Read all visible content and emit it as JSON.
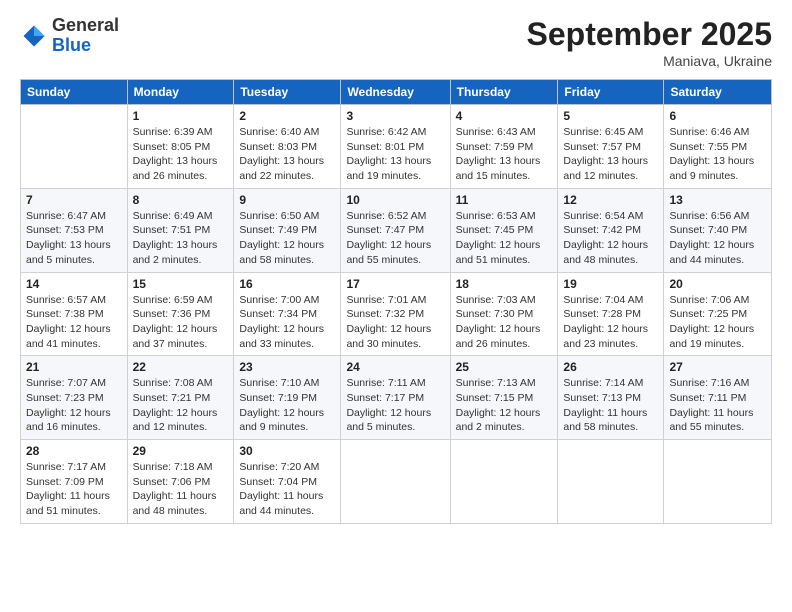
{
  "header": {
    "logo_general": "General",
    "logo_blue": "Blue",
    "month_title": "September 2025",
    "location": "Maniava, Ukraine"
  },
  "days_of_week": [
    "Sunday",
    "Monday",
    "Tuesday",
    "Wednesday",
    "Thursday",
    "Friday",
    "Saturday"
  ],
  "weeks": [
    [
      null,
      {
        "day": 1,
        "sunrise": "Sunrise: 6:39 AM",
        "sunset": "Sunset: 8:05 PM",
        "daylight": "Daylight: 13 hours and 26 minutes."
      },
      {
        "day": 2,
        "sunrise": "Sunrise: 6:40 AM",
        "sunset": "Sunset: 8:03 PM",
        "daylight": "Daylight: 13 hours and 22 minutes."
      },
      {
        "day": 3,
        "sunrise": "Sunrise: 6:42 AM",
        "sunset": "Sunset: 8:01 PM",
        "daylight": "Daylight: 13 hours and 19 minutes."
      },
      {
        "day": 4,
        "sunrise": "Sunrise: 6:43 AM",
        "sunset": "Sunset: 7:59 PM",
        "daylight": "Daylight: 13 hours and 15 minutes."
      },
      {
        "day": 5,
        "sunrise": "Sunrise: 6:45 AM",
        "sunset": "Sunset: 7:57 PM",
        "daylight": "Daylight: 13 hours and 12 minutes."
      },
      {
        "day": 6,
        "sunrise": "Sunrise: 6:46 AM",
        "sunset": "Sunset: 7:55 PM",
        "daylight": "Daylight: 13 hours and 9 minutes."
      }
    ],
    [
      {
        "day": 7,
        "sunrise": "Sunrise: 6:47 AM",
        "sunset": "Sunset: 7:53 PM",
        "daylight": "Daylight: 13 hours and 5 minutes."
      },
      {
        "day": 8,
        "sunrise": "Sunrise: 6:49 AM",
        "sunset": "Sunset: 7:51 PM",
        "daylight": "Daylight: 13 hours and 2 minutes."
      },
      {
        "day": 9,
        "sunrise": "Sunrise: 6:50 AM",
        "sunset": "Sunset: 7:49 PM",
        "daylight": "Daylight: 12 hours and 58 minutes."
      },
      {
        "day": 10,
        "sunrise": "Sunrise: 6:52 AM",
        "sunset": "Sunset: 7:47 PM",
        "daylight": "Daylight: 12 hours and 55 minutes."
      },
      {
        "day": 11,
        "sunrise": "Sunrise: 6:53 AM",
        "sunset": "Sunset: 7:45 PM",
        "daylight": "Daylight: 12 hours and 51 minutes."
      },
      {
        "day": 12,
        "sunrise": "Sunrise: 6:54 AM",
        "sunset": "Sunset: 7:42 PM",
        "daylight": "Daylight: 12 hours and 48 minutes."
      },
      {
        "day": 13,
        "sunrise": "Sunrise: 6:56 AM",
        "sunset": "Sunset: 7:40 PM",
        "daylight": "Daylight: 12 hours and 44 minutes."
      }
    ],
    [
      {
        "day": 14,
        "sunrise": "Sunrise: 6:57 AM",
        "sunset": "Sunset: 7:38 PM",
        "daylight": "Daylight: 12 hours and 41 minutes."
      },
      {
        "day": 15,
        "sunrise": "Sunrise: 6:59 AM",
        "sunset": "Sunset: 7:36 PM",
        "daylight": "Daylight: 12 hours and 37 minutes."
      },
      {
        "day": 16,
        "sunrise": "Sunrise: 7:00 AM",
        "sunset": "Sunset: 7:34 PM",
        "daylight": "Daylight: 12 hours and 33 minutes."
      },
      {
        "day": 17,
        "sunrise": "Sunrise: 7:01 AM",
        "sunset": "Sunset: 7:32 PM",
        "daylight": "Daylight: 12 hours and 30 minutes."
      },
      {
        "day": 18,
        "sunrise": "Sunrise: 7:03 AM",
        "sunset": "Sunset: 7:30 PM",
        "daylight": "Daylight: 12 hours and 26 minutes."
      },
      {
        "day": 19,
        "sunrise": "Sunrise: 7:04 AM",
        "sunset": "Sunset: 7:28 PM",
        "daylight": "Daylight: 12 hours and 23 minutes."
      },
      {
        "day": 20,
        "sunrise": "Sunrise: 7:06 AM",
        "sunset": "Sunset: 7:25 PM",
        "daylight": "Daylight: 12 hours and 19 minutes."
      }
    ],
    [
      {
        "day": 21,
        "sunrise": "Sunrise: 7:07 AM",
        "sunset": "Sunset: 7:23 PM",
        "daylight": "Daylight: 12 hours and 16 minutes."
      },
      {
        "day": 22,
        "sunrise": "Sunrise: 7:08 AM",
        "sunset": "Sunset: 7:21 PM",
        "daylight": "Daylight: 12 hours and 12 minutes."
      },
      {
        "day": 23,
        "sunrise": "Sunrise: 7:10 AM",
        "sunset": "Sunset: 7:19 PM",
        "daylight": "Daylight: 12 hours and 9 minutes."
      },
      {
        "day": 24,
        "sunrise": "Sunrise: 7:11 AM",
        "sunset": "Sunset: 7:17 PM",
        "daylight": "Daylight: 12 hours and 5 minutes."
      },
      {
        "day": 25,
        "sunrise": "Sunrise: 7:13 AM",
        "sunset": "Sunset: 7:15 PM",
        "daylight": "Daylight: 12 hours and 2 minutes."
      },
      {
        "day": 26,
        "sunrise": "Sunrise: 7:14 AM",
        "sunset": "Sunset: 7:13 PM",
        "daylight": "Daylight: 11 hours and 58 minutes."
      },
      {
        "day": 27,
        "sunrise": "Sunrise: 7:16 AM",
        "sunset": "Sunset: 7:11 PM",
        "daylight": "Daylight: 11 hours and 55 minutes."
      }
    ],
    [
      {
        "day": 28,
        "sunrise": "Sunrise: 7:17 AM",
        "sunset": "Sunset: 7:09 PM",
        "daylight": "Daylight: 11 hours and 51 minutes."
      },
      {
        "day": 29,
        "sunrise": "Sunrise: 7:18 AM",
        "sunset": "Sunset: 7:06 PM",
        "daylight": "Daylight: 11 hours and 48 minutes."
      },
      {
        "day": 30,
        "sunrise": "Sunrise: 7:20 AM",
        "sunset": "Sunset: 7:04 PM",
        "daylight": "Daylight: 11 hours and 44 minutes."
      },
      null,
      null,
      null,
      null
    ]
  ]
}
